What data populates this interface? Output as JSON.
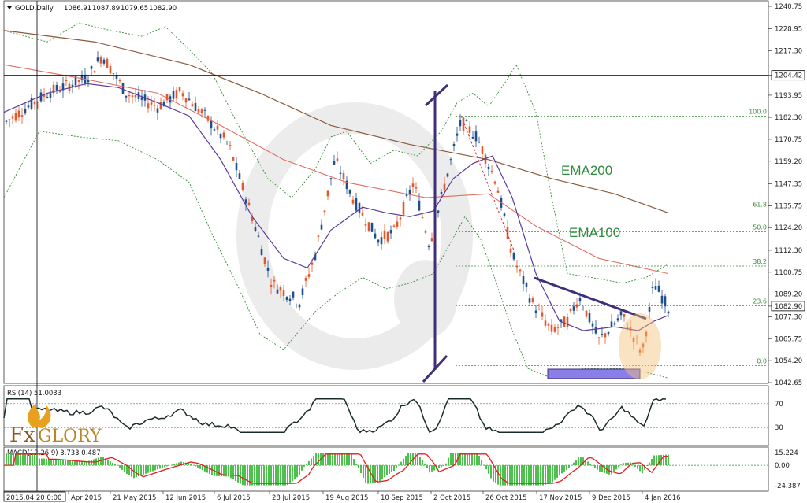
{
  "header": {
    "symbol": "GOLD,Daily",
    "o": "1086.91",
    "h": "1087.89",
    "l": "1079.65",
    "c": "1082.90"
  },
  "chart_data": {
    "type": "candlestick",
    "price_axis_labels": [
      "1240.75",
      "1228.95",
      "1217.30",
      "1204.42",
      "1193.95",
      "1182.30",
      "1170.75",
      "1159.20",
      "1147.35",
      "1135.75",
      "1124.20",
      "1112.30",
      "1100.75",
      "1089.20",
      "1082.90",
      "1077.30",
      "1065.75",
      "1054.20",
      "1042.65"
    ],
    "highlighted_prices": [
      "1204.42",
      "1082.90"
    ],
    "date_labels": [
      "2015.04.20 0:00",
      "Apr 2015",
      "21 May 2015",
      "12 Jun 2015",
      "6 Jul 2015",
      "28 Jul 2015",
      "19 Aug 2015",
      "10 Sep 2015",
      "2 Oct 2015",
      "26 Oct 2015",
      "17 Nov 2015",
      "9 Dec 2015",
      "4 Jan 2016"
    ],
    "fibonacci": [
      {
        "label": "100.0",
        "price": 1183.0
      },
      {
        "label": "61.8",
        "price": 1134.0
      },
      {
        "label": "50.0",
        "price": 1122.0
      },
      {
        "label": "38.2",
        "price": 1104.0
      },
      {
        "label": "23.6",
        "price": 1083.0
      },
      {
        "label": "0.0",
        "price": 1051.5
      }
    ],
    "ema_labels": [
      {
        "text": "EMA200",
        "color": "#2e8b3e"
      },
      {
        "text": "EMA100",
        "color": "#2e8b3e"
      }
    ],
    "rsi": {
      "label": "RSI(14) 51.0033",
      "levels": [
        "70",
        "30"
      ],
      "axis_top": "100"
    },
    "macd": {
      "label": "MACD(12,26,9) 3.733 0.487",
      "ticks": [
        "15.224",
        "0.00",
        "-24.387"
      ]
    },
    "colors": {
      "bull": "#1f4e8c",
      "bear": "#e2572b",
      "ema100": "#e07060",
      "ema200": "#8b5a3c",
      "bb": "#3a8a3a",
      "ma": "#5b3a9c",
      "trend": "#3f2f78",
      "rsi": "#1a2b2b",
      "macd_hist": "#4dc04d",
      "macd_signal": "#e02020"
    }
  },
  "logo": {
    "part1": "Fx",
    "part2": "GLORY"
  }
}
